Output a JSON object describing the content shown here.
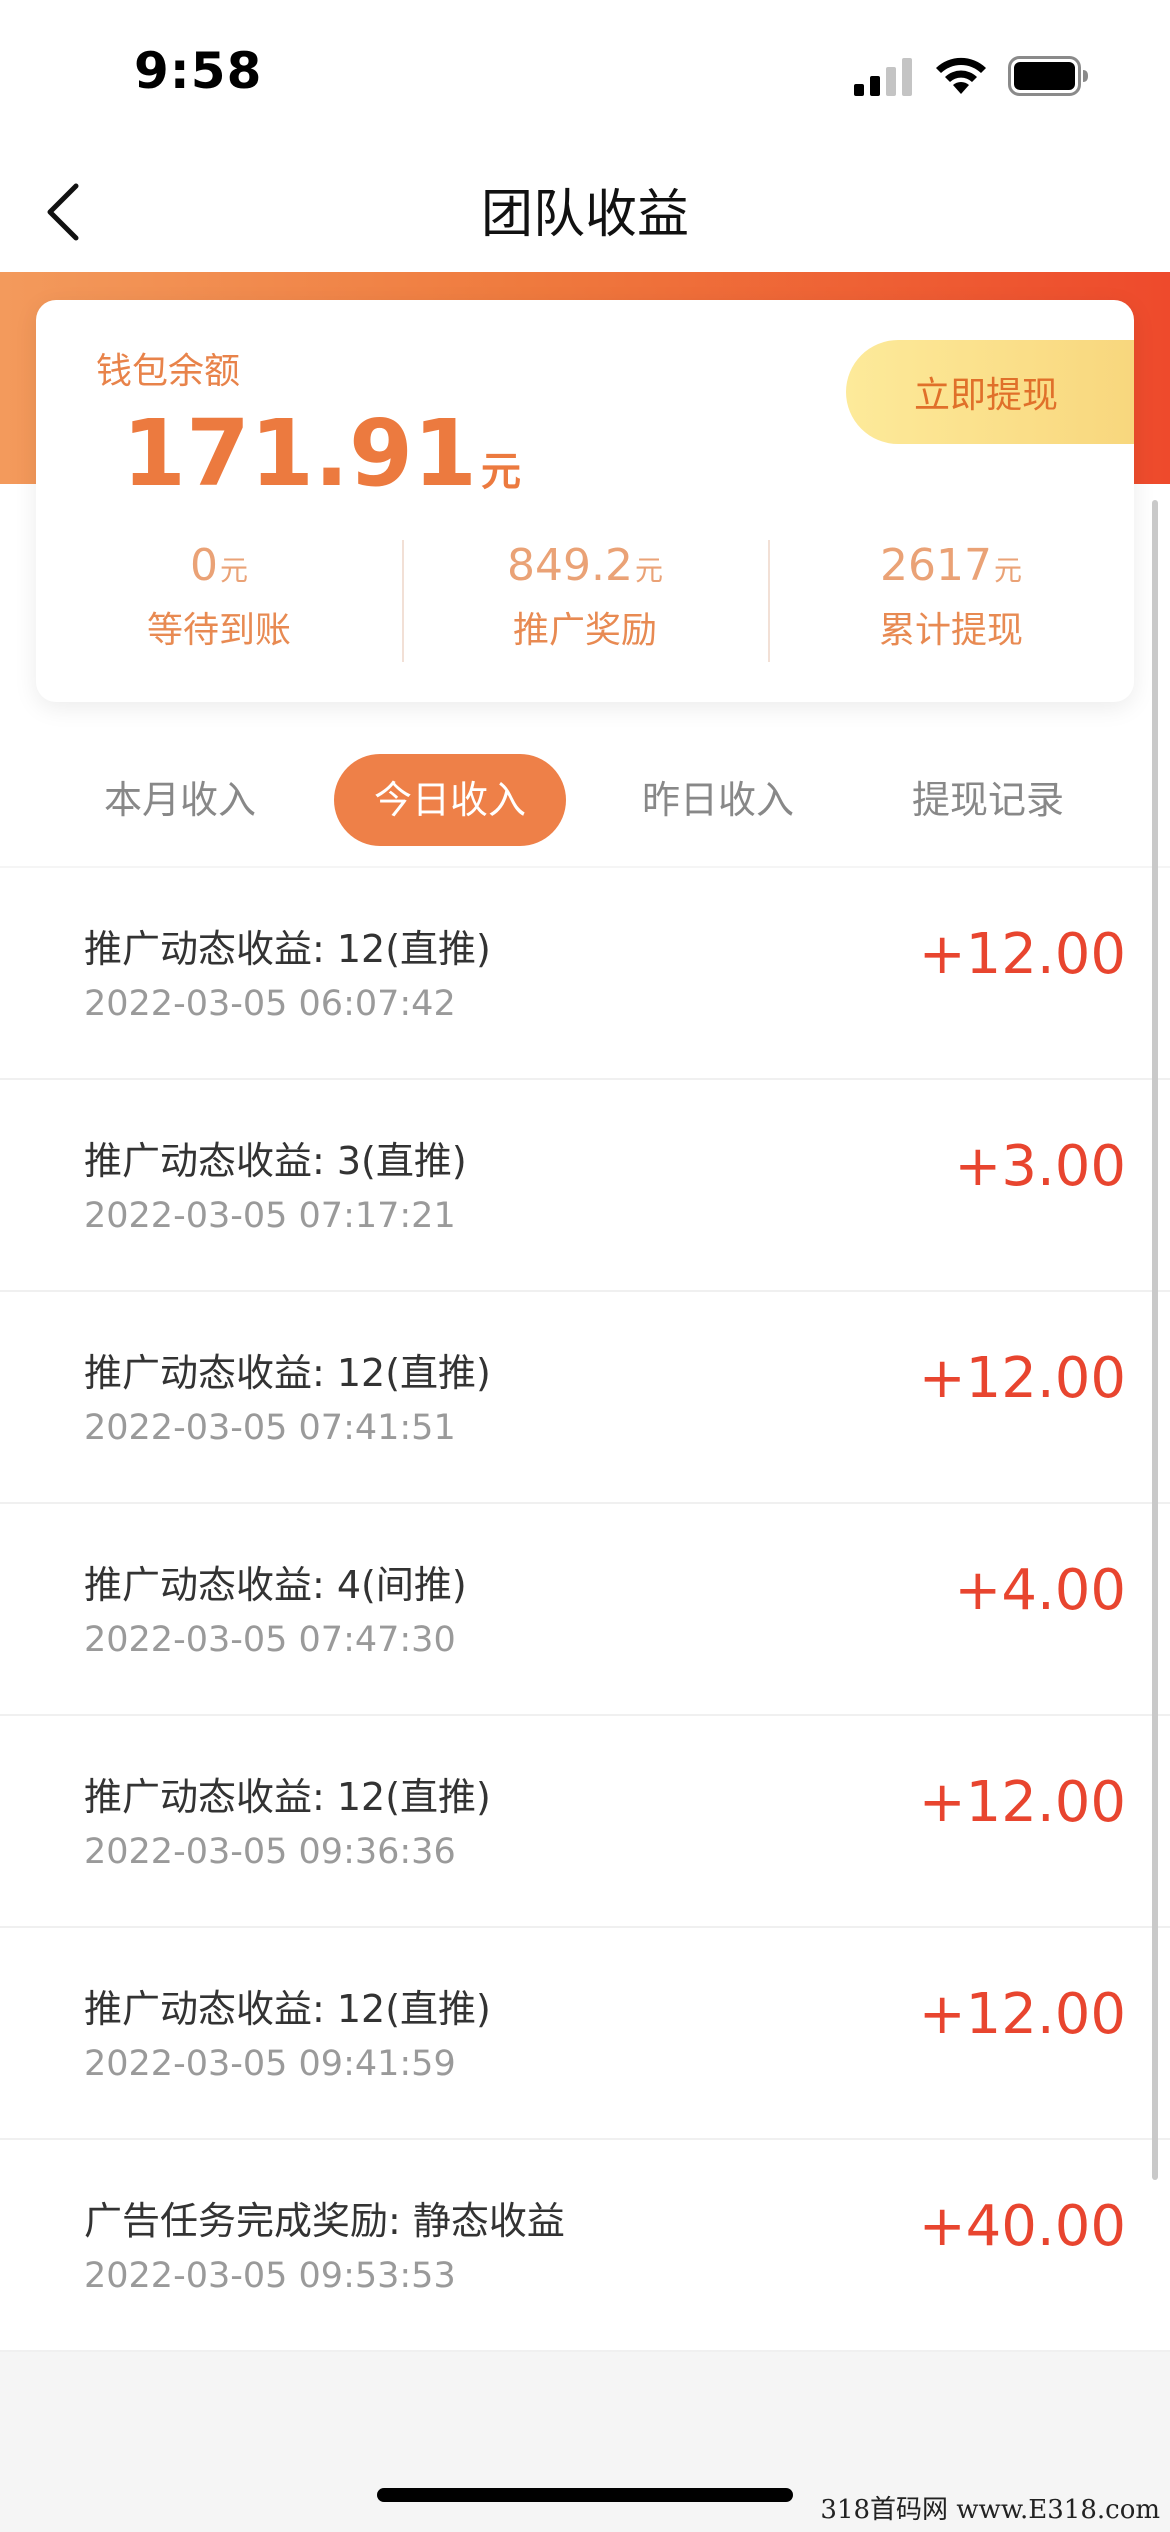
{
  "status_bar": {
    "time": "9:58"
  },
  "nav": {
    "title": "团队收益"
  },
  "wallet": {
    "label": "钱包余额",
    "amount": "171.91",
    "unit": "元",
    "withdraw_label": "立即提现",
    "stats": [
      {
        "value": "0",
        "unit": "元",
        "label": "等待到账"
      },
      {
        "value": "849.2",
        "unit": "元",
        "label": "推广奖励"
      },
      {
        "value": "2617",
        "unit": "元",
        "label": "累计提现"
      }
    ]
  },
  "tabs": [
    {
      "label": "本月收入",
      "active": false
    },
    {
      "label": "今日收入",
      "active": true
    },
    {
      "label": "昨日收入",
      "active": false
    },
    {
      "label": "提现记录",
      "active": false
    }
  ],
  "records": [
    {
      "title": "推广动态收益: 12(直推)",
      "time": "2022-03-05 06:07:42",
      "amount": "+12.00"
    },
    {
      "title": "推广动态收益: 3(直推)",
      "time": "2022-03-05 07:17:21",
      "amount": "+3.00"
    },
    {
      "title": "推广动态收益: 12(直推)",
      "time": "2022-03-05 07:41:51",
      "amount": "+12.00"
    },
    {
      "title": "推广动态收益: 4(间推)",
      "time": "2022-03-05 07:47:30",
      "amount": "+4.00"
    },
    {
      "title": "推广动态收益: 12(直推)",
      "time": "2022-03-05 09:36:36",
      "amount": "+12.00"
    },
    {
      "title": "推广动态收益: 12(直推)",
      "time": "2022-03-05 09:41:59",
      "amount": "+12.00"
    },
    {
      "title": "广告任务完成奖励: 静态收益",
      "time": "2022-03-05 09:53:53",
      "amount": "+40.00"
    }
  ],
  "watermark": "318首码网 www.E318.com",
  "colors": {
    "accent": "#ee8048",
    "amount_red": "#e8452f",
    "gradient_end": "#ee4a2c"
  }
}
